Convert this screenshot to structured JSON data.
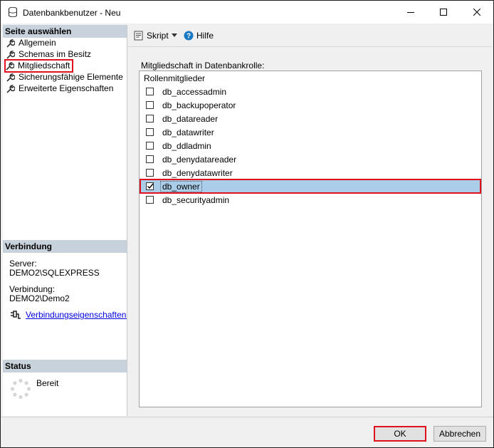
{
  "window": {
    "title": "Datenbankbenutzer - Neu"
  },
  "left": {
    "select_page_header": "Seite auswählen",
    "nav": [
      {
        "label": "Allgemein"
      },
      {
        "label": "Schemas im Besitz"
      },
      {
        "label": "Mitgliedschaft"
      },
      {
        "label": "Sicherungsfähige Elemente"
      },
      {
        "label": "Erweiterte Eigenschaften"
      }
    ],
    "connection_header": "Verbindung",
    "server_label": "Server:",
    "server_value": "DEMO2\\SQLEXPRESS",
    "connection_label": "Verbindung:",
    "connection_value": "DEMO2\\Demo2",
    "connection_link": "Verbindungseigenschaften anzeigen",
    "status_header": "Status",
    "status_value": "Bereit"
  },
  "toolbar": {
    "script_label": "Skript",
    "help_label": "Hilfe"
  },
  "content": {
    "group_label": "Mitgliedschaft in Datenbankrolle:",
    "list_header": "Rollenmitglieder",
    "roles": [
      {
        "name": "db_accessadmin",
        "checked": false
      },
      {
        "name": "db_backupoperator",
        "checked": false
      },
      {
        "name": "db_datareader",
        "checked": false
      },
      {
        "name": "db_datawriter",
        "checked": false
      },
      {
        "name": "db_ddladmin",
        "checked": false
      },
      {
        "name": "db_denydatareader",
        "checked": false
      },
      {
        "name": "db_denydatawriter",
        "checked": false
      },
      {
        "name": "db_owner",
        "checked": true
      },
      {
        "name": "db_securityadmin",
        "checked": false
      }
    ]
  },
  "buttons": {
    "ok": "OK",
    "cancel": "Abbrechen"
  },
  "colors": {
    "highlight": "#e0101e",
    "selection": "#aacde9",
    "section_header": "#c8d2dc",
    "link": "#0000e0"
  }
}
